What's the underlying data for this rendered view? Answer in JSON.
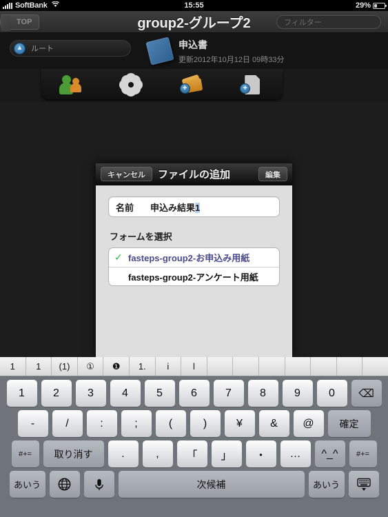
{
  "status_bar": {
    "carrier": "SoftBank",
    "wifi_icon": "wifi-icon",
    "time": "15:55",
    "battery_percent": "29%",
    "battery_level": 29
  },
  "nav_bar": {
    "back_label": "TOP",
    "title": "group2-グループ2",
    "filter_placeholder": "フィルター",
    "filter_value": ""
  },
  "doc_header": {
    "route_label": "ルート",
    "route_icon": "up-arrow-icon",
    "doc_icon": "blue-book-icon",
    "doc_title": "申込書",
    "doc_subtitle": "更新2012年10月12日 09時33分"
  },
  "tab_bar": {
    "tabs": [
      {
        "name": "users-tab",
        "icon": "users-icon"
      },
      {
        "name": "settings-tab",
        "icon": "gear-icon"
      },
      {
        "name": "add-folder-tab",
        "icon": "add-folder-icon"
      },
      {
        "name": "add-file-tab",
        "icon": "add-file-icon"
      }
    ],
    "plus_glyph": "+"
  },
  "modal": {
    "cancel_label": "キャンセル",
    "title": "ファイルの追加",
    "edit_label": "編集",
    "name_label": "名前",
    "name_value_prefix": "申込み結果",
    "name_value_selected": "1",
    "section_title": "フォームを選択",
    "check_glyph": "✓",
    "forms": [
      {
        "label": "fasteps-group2-お申込み用紙",
        "selected": true
      },
      {
        "label": "fasteps-group2-アンケート用紙",
        "selected": false
      }
    ]
  },
  "keyboard": {
    "candidates": [
      "1",
      "1",
      "(1)",
      "①",
      "❶",
      "1.",
      "i",
      "l",
      "",
      "",
      "",
      "",
      "",
      "",
      ""
    ],
    "row1": [
      "1",
      "2",
      "3",
      "4",
      "5",
      "6",
      "7",
      "8",
      "9",
      "0"
    ],
    "backspace_glyph": "⌫",
    "row2": [
      "-",
      "/",
      ":",
      ";",
      "(",
      ")",
      "¥",
      "&",
      "@"
    ],
    "confirm_label": "確定",
    "row3_left": "#+=",
    "undo_label": "取り消す",
    "row3": [
      ".",
      ",",
      "「",
      "」",
      "・",
      "…",
      "^_^"
    ],
    "row3_right": "#+=",
    "kana_left": "あいう",
    "globe_glyph": "🌐",
    "mic_glyph": "🎤",
    "space_label": "次候補",
    "kana_right": "あいう",
    "dismiss_glyph": "⌨"
  },
  "colors": {
    "accent_blue": "#3a7fba",
    "check_green": "#2db83d",
    "selected_text": "#4a4a8c",
    "keyboard_bg": "#6f737a",
    "modal_bg": "#dedede"
  }
}
